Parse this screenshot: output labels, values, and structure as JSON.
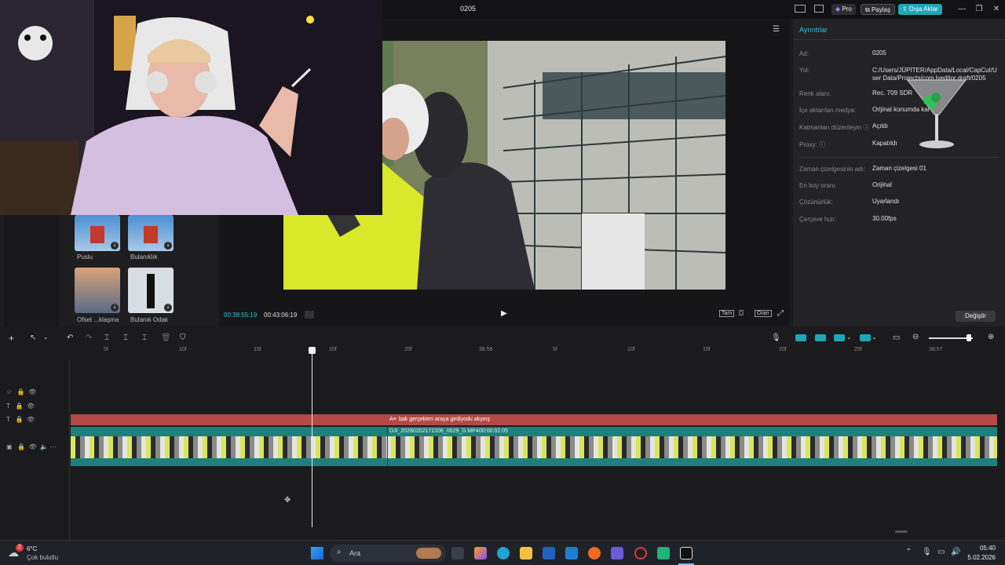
{
  "app": {
    "title": "0205",
    "pro_label": "Pro",
    "share_label": "Paylaş",
    "export_label": "Dışa Aktar"
  },
  "media_panel": {
    "items": [
      {
        "label": "Puslu"
      },
      {
        "label": "Bulanıklık"
      },
      {
        "label": "Ofset ...klaşma"
      },
      {
        "label": "Bulanık Odak"
      }
    ]
  },
  "preview": {
    "current_time": "00:38:55:19",
    "total_time": "00:43:06:19",
    "full_label": "Tam",
    "ratio_label": "Oran"
  },
  "details": {
    "header": "Ayrıntılar",
    "rows": [
      {
        "label": "Ad:",
        "value": "0205"
      },
      {
        "label": "Yol:",
        "value": "C:/Users/JÜPİTER/AppData/Local/CapCut/User Data/Projects/com.lveditor.draft/0205"
      },
      {
        "label": "Renk alanı:",
        "value": "Rec. 709 SDR"
      },
      {
        "label": "İçe aktarılan medya:",
        "value": "Orijinal konumda kal"
      },
      {
        "label": "Katmanları düzenleyin ⓘ",
        "value": "Açıldı"
      },
      {
        "label": "Proxy: ⓘ",
        "value": "Kapatıldı"
      },
      {
        "label": "Zaman çizelgesinin adı:",
        "value": "Zaman çizelgesi 01"
      },
      {
        "label": "En boy oranı:",
        "value": "Orijinal"
      },
      {
        "label": "Çözünürlük:",
        "value": "Uyarlandı"
      },
      {
        "label": "Çerçeve hızı:",
        "value": "30.00fps"
      }
    ],
    "change_label": "Değiştir"
  },
  "timeline": {
    "ticks": [
      "5f",
      "10f",
      "15f",
      "20f",
      "25f",
      "38:56",
      "5f",
      "10f",
      "15f",
      "20f",
      "25f",
      "38:57"
    ],
    "text_clip": "bak gerçekten araya girdiyodu akşmş",
    "video_clip_name": "DJI_20260202172206_0029_D.MP4",
    "video_clip_duration": "00:00:02:05"
  },
  "taskbar": {
    "weather_temp": "6°C",
    "weather_desc": "Çok bulutlu",
    "weather_badge": "2",
    "search_placeholder": "Ara",
    "time": "05:40",
    "date": "5.02.2026"
  },
  "colors": {
    "accent": "#1ea7b8",
    "text_clip": "#b34a45",
    "video_clip": "#1f7f7a"
  }
}
